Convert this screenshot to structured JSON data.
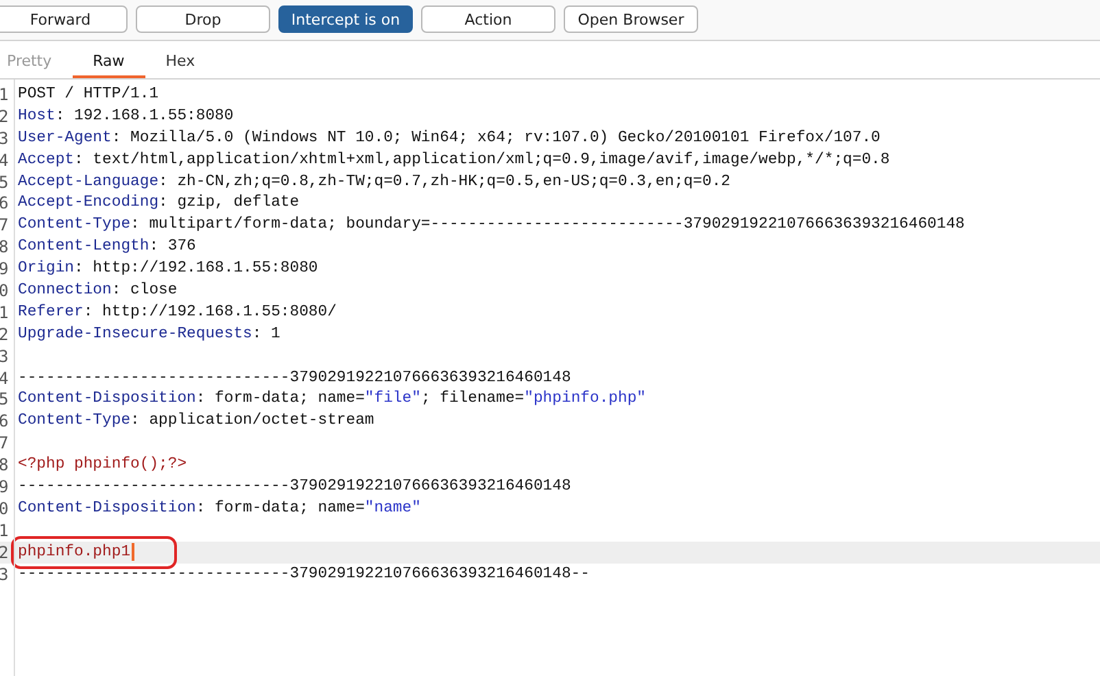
{
  "toolbar": [
    {
      "label": "Forward",
      "on": false
    },
    {
      "label": "Drop",
      "on": false
    },
    {
      "label": "Intercept is on",
      "on": true
    },
    {
      "label": "Action",
      "on": false
    },
    {
      "label": "Open Browser",
      "on": false
    }
  ],
  "tabs": [
    {
      "label": "Pretty",
      "selected": false,
      "disabled": true
    },
    {
      "label": "Raw",
      "selected": true,
      "disabled": false
    },
    {
      "label": "Hex",
      "selected": false,
      "disabled": false
    }
  ],
  "lines": [
    {
      "number": "1",
      "segments": [
        {
          "kind": "text",
          "text": "POST / HTTP/1.1"
        }
      ]
    },
    {
      "number": "2",
      "segments": [
        {
          "kind": "name",
          "text": "Host"
        },
        {
          "kind": "text",
          "text": ": 192.168.1.55:8080"
        }
      ]
    },
    {
      "number": "3",
      "segments": [
        {
          "kind": "name",
          "text": "User-Agent"
        },
        {
          "kind": "text",
          "text": ": Mozilla/5.0 (Windows NT 10.0; Win64; x64; rv:107.0) Gecko/20100101 Firefox/107.0"
        }
      ]
    },
    {
      "number": "4",
      "segments": [
        {
          "kind": "name",
          "text": "Accept"
        },
        {
          "kind": "text",
          "text": ": text/html,application/xhtml+xml,application/xml;q=0.9,image/avif,image/webp,*/*;q=0.8"
        }
      ]
    },
    {
      "number": "5",
      "segments": [
        {
          "kind": "name",
          "text": "Accept-Language"
        },
        {
          "kind": "text",
          "text": ": zh-CN,zh;q=0.8,zh-TW;q=0.7,zh-HK;q=0.5,en-US;q=0.3,en;q=0.2"
        }
      ]
    },
    {
      "number": "6",
      "segments": [
        {
          "kind": "name",
          "text": "Accept-Encoding"
        },
        {
          "kind": "text",
          "text": ": gzip, deflate"
        }
      ]
    },
    {
      "number": "7",
      "segments": [
        {
          "kind": "name",
          "text": "Content-Type"
        },
        {
          "kind": "text",
          "text": ": multipart/form-data; boundary=---------------------------379029192210766636393216460148"
        }
      ]
    },
    {
      "number": "8",
      "segments": [
        {
          "kind": "name",
          "text": "Content-Length"
        },
        {
          "kind": "text",
          "text": ": 376"
        }
      ]
    },
    {
      "number": "9",
      "segments": [
        {
          "kind": "name",
          "text": "Origin"
        },
        {
          "kind": "text",
          "text": ": http://192.168.1.55:8080"
        }
      ]
    },
    {
      "number": "0",
      "segments": [
        {
          "kind": "name",
          "text": "Connection"
        },
        {
          "kind": "text",
          "text": ": close"
        }
      ]
    },
    {
      "number": "1",
      "segments": [
        {
          "kind": "name",
          "text": "Referer"
        },
        {
          "kind": "text",
          "text": ": http://192.168.1.55:8080/"
        }
      ]
    },
    {
      "number": "2",
      "segments": [
        {
          "kind": "name",
          "text": "Upgrade-Insecure-Requests"
        },
        {
          "kind": "text",
          "text": ": 1"
        }
      ]
    },
    {
      "number": "3"
    },
    {
      "number": "4",
      "segments": [
        {
          "kind": "text",
          "text": "-----------------------------379029192210766636393216460148"
        }
      ]
    },
    {
      "number": "5",
      "segments": [
        {
          "kind": "name",
          "text": "Content-Disposition"
        },
        {
          "kind": "text",
          "text": ": form-data; name="
        },
        {
          "kind": "value",
          "text": "\"file\""
        },
        {
          "kind": "text",
          "text": "; filename="
        },
        {
          "kind": "value",
          "text": "\"phpinfo.php\""
        }
      ]
    },
    {
      "number": "6",
      "segments": [
        {
          "kind": "name",
          "text": "Content-Type"
        },
        {
          "kind": "text",
          "text": ": application/octet-stream"
        }
      ]
    },
    {
      "number": "7"
    },
    {
      "number": "8",
      "segments": [
        {
          "kind": "code",
          "text": "<?php phpinfo();?>"
        }
      ]
    },
    {
      "number": "9",
      "segments": [
        {
          "kind": "text",
          "text": "-----------------------------379029192210766636393216460148"
        }
      ]
    },
    {
      "number": "0",
      "segments": [
        {
          "kind": "name",
          "text": "Content-Disposition"
        },
        {
          "kind": "text",
          "text": ": form-data; name="
        },
        {
          "kind": "value",
          "text": "\"name\""
        }
      ]
    },
    {
      "number": "1"
    },
    {
      "number": "2",
      "segments": [
        {
          "kind": "code",
          "text": "phpinfo.php1"
        }
      ],
      "selected": true,
      "annotated": true,
      "cursor": true
    },
    {
      "number": "3",
      "segments": [
        {
          "kind": "text",
          "text": "-----------------------------379029192210766636393216460148--"
        }
      ]
    }
  ]
}
